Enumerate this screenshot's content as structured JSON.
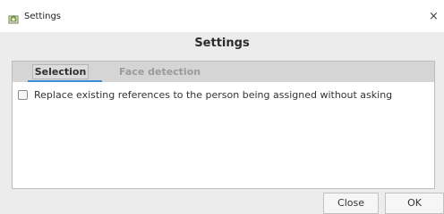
{
  "window": {
    "title": "Settings",
    "icon": "settings-app-icon",
    "close_glyph": "×"
  },
  "header": {
    "title": "Settings"
  },
  "tabs": [
    {
      "label": "Selection",
      "selected": true
    },
    {
      "label": "Face detection",
      "selected": false
    }
  ],
  "selection_tab": {
    "options": [
      {
        "label": "Replace existing references to the person being assigned without asking",
        "checked": false
      }
    ]
  },
  "buttons": {
    "close_label": "Close",
    "ok_label": "OK"
  },
  "colors": {
    "accent": "#3c8fd6",
    "background": "#ececec",
    "tab_strip": "#d5d5d5"
  }
}
